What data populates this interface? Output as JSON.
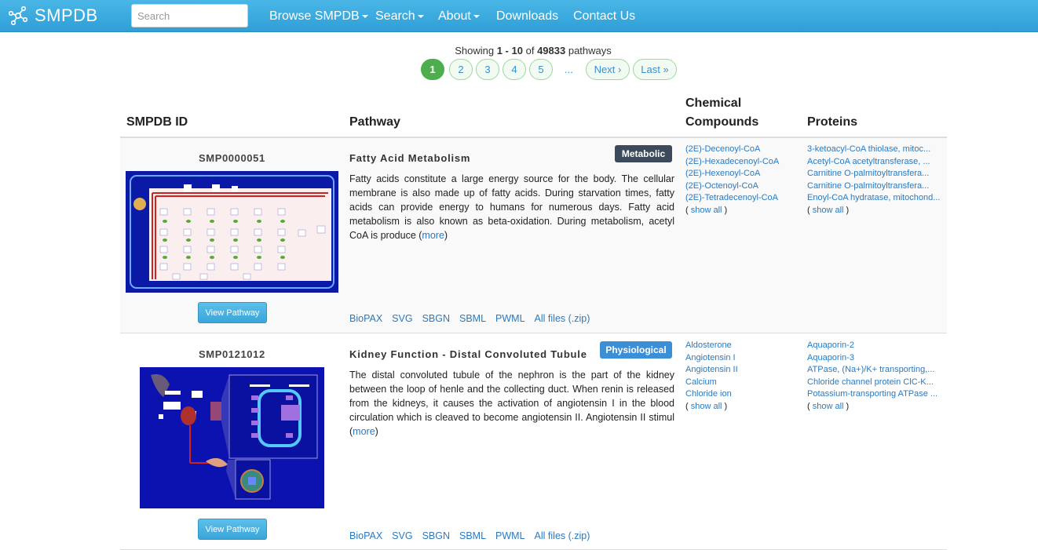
{
  "app": {
    "title": "SMPDB"
  },
  "search": {
    "placeholder": "Search"
  },
  "nav": {
    "browse": "Browse SMPDB",
    "search": "Search",
    "about": "About",
    "downloads": "Downloads",
    "contact": "Contact Us"
  },
  "pagination": {
    "showing_prefix": "Showing",
    "range": "1 - 10",
    "of": "of",
    "total": "49833",
    "suffix": "pathways",
    "pages": [
      "1",
      "2",
      "3",
      "4",
      "5"
    ],
    "ellipsis": "...",
    "next": "Next ›",
    "last": "Last »"
  },
  "table": {
    "headers": {
      "id": "SMPDB ID",
      "pathway": "Pathway",
      "chemical": "Chemical",
      "compounds": "Compounds",
      "proteins": "Proteins"
    },
    "rows": [
      {
        "id": "SMP0000051",
        "title": "Fatty Acid Metabolism",
        "badge": "Metabolic",
        "badge_color": "#3d4a5c",
        "description": "Fatty acids constitute a large energy source for the body. The cellular membrane is also made up of fatty acids. During starvation times, fatty acids can provide energy to humans for numerous days. Fatty acid metabolism is also known as beta-oxidation. During metabolism, acetyl CoA is produce",
        "more": "more",
        "view_button": "View Pathway",
        "files": [
          "BioPAX",
          "SVG",
          "SBGN",
          "SBML",
          "PWML",
          "All files (.zip)"
        ],
        "compounds": [
          "(2E)-Decenoyl-CoA",
          "(2E)-Hexadecenoyl-CoA",
          "(2E)-Hexenoyl-CoA",
          "(2E)-Octenoyl-CoA",
          "(2E)-Tetradecenoyl-CoA"
        ],
        "proteins": [
          "3-ketoacyl-CoA thiolase, mitoc...",
          "Acetyl-CoA acetyltransferase, ...",
          "Carnitine O-palmitoyltransfera...",
          "Carnitine O-palmitoyltransfera...",
          "Enoyl-CoA hydratase, mitochond..."
        ],
        "show_all": "show all"
      },
      {
        "id": "SMP0121012",
        "title": "Kidney Function - Distal Convoluted Tubule",
        "badge": "Physiological",
        "badge_color": "#3a8fd6",
        "description": "The distal convoluted tubule of the nephron is the part of the kidney between the loop of henle and the collecting duct. When renin is released from the kidneys, it causes the activation of angiotensin I in the blood circulation which is cleaved to become angiotensin II. Angiotensin II stimul",
        "more": "more",
        "view_button": "View Pathway",
        "files": [
          "BioPAX",
          "SVG",
          "SBGN",
          "SBML",
          "PWML",
          "All files (.zip)"
        ],
        "compounds": [
          "Aldosterone",
          "Angiotensin I",
          "Angiotensin II",
          "Calcium",
          "Chloride ion"
        ],
        "proteins": [
          "Aquaporin-2",
          "Aquaporin-3",
          "ATPase, (Na+)/K+ transporting,...",
          "Chloride channel protein ClC-K...",
          "Potassium-transporting ATPase ..."
        ],
        "show_all": "show all"
      }
    ]
  },
  "colors": {
    "navbar": "#3aa8de",
    "link": "#2a7ac0",
    "active_page": "#4cae4c"
  }
}
